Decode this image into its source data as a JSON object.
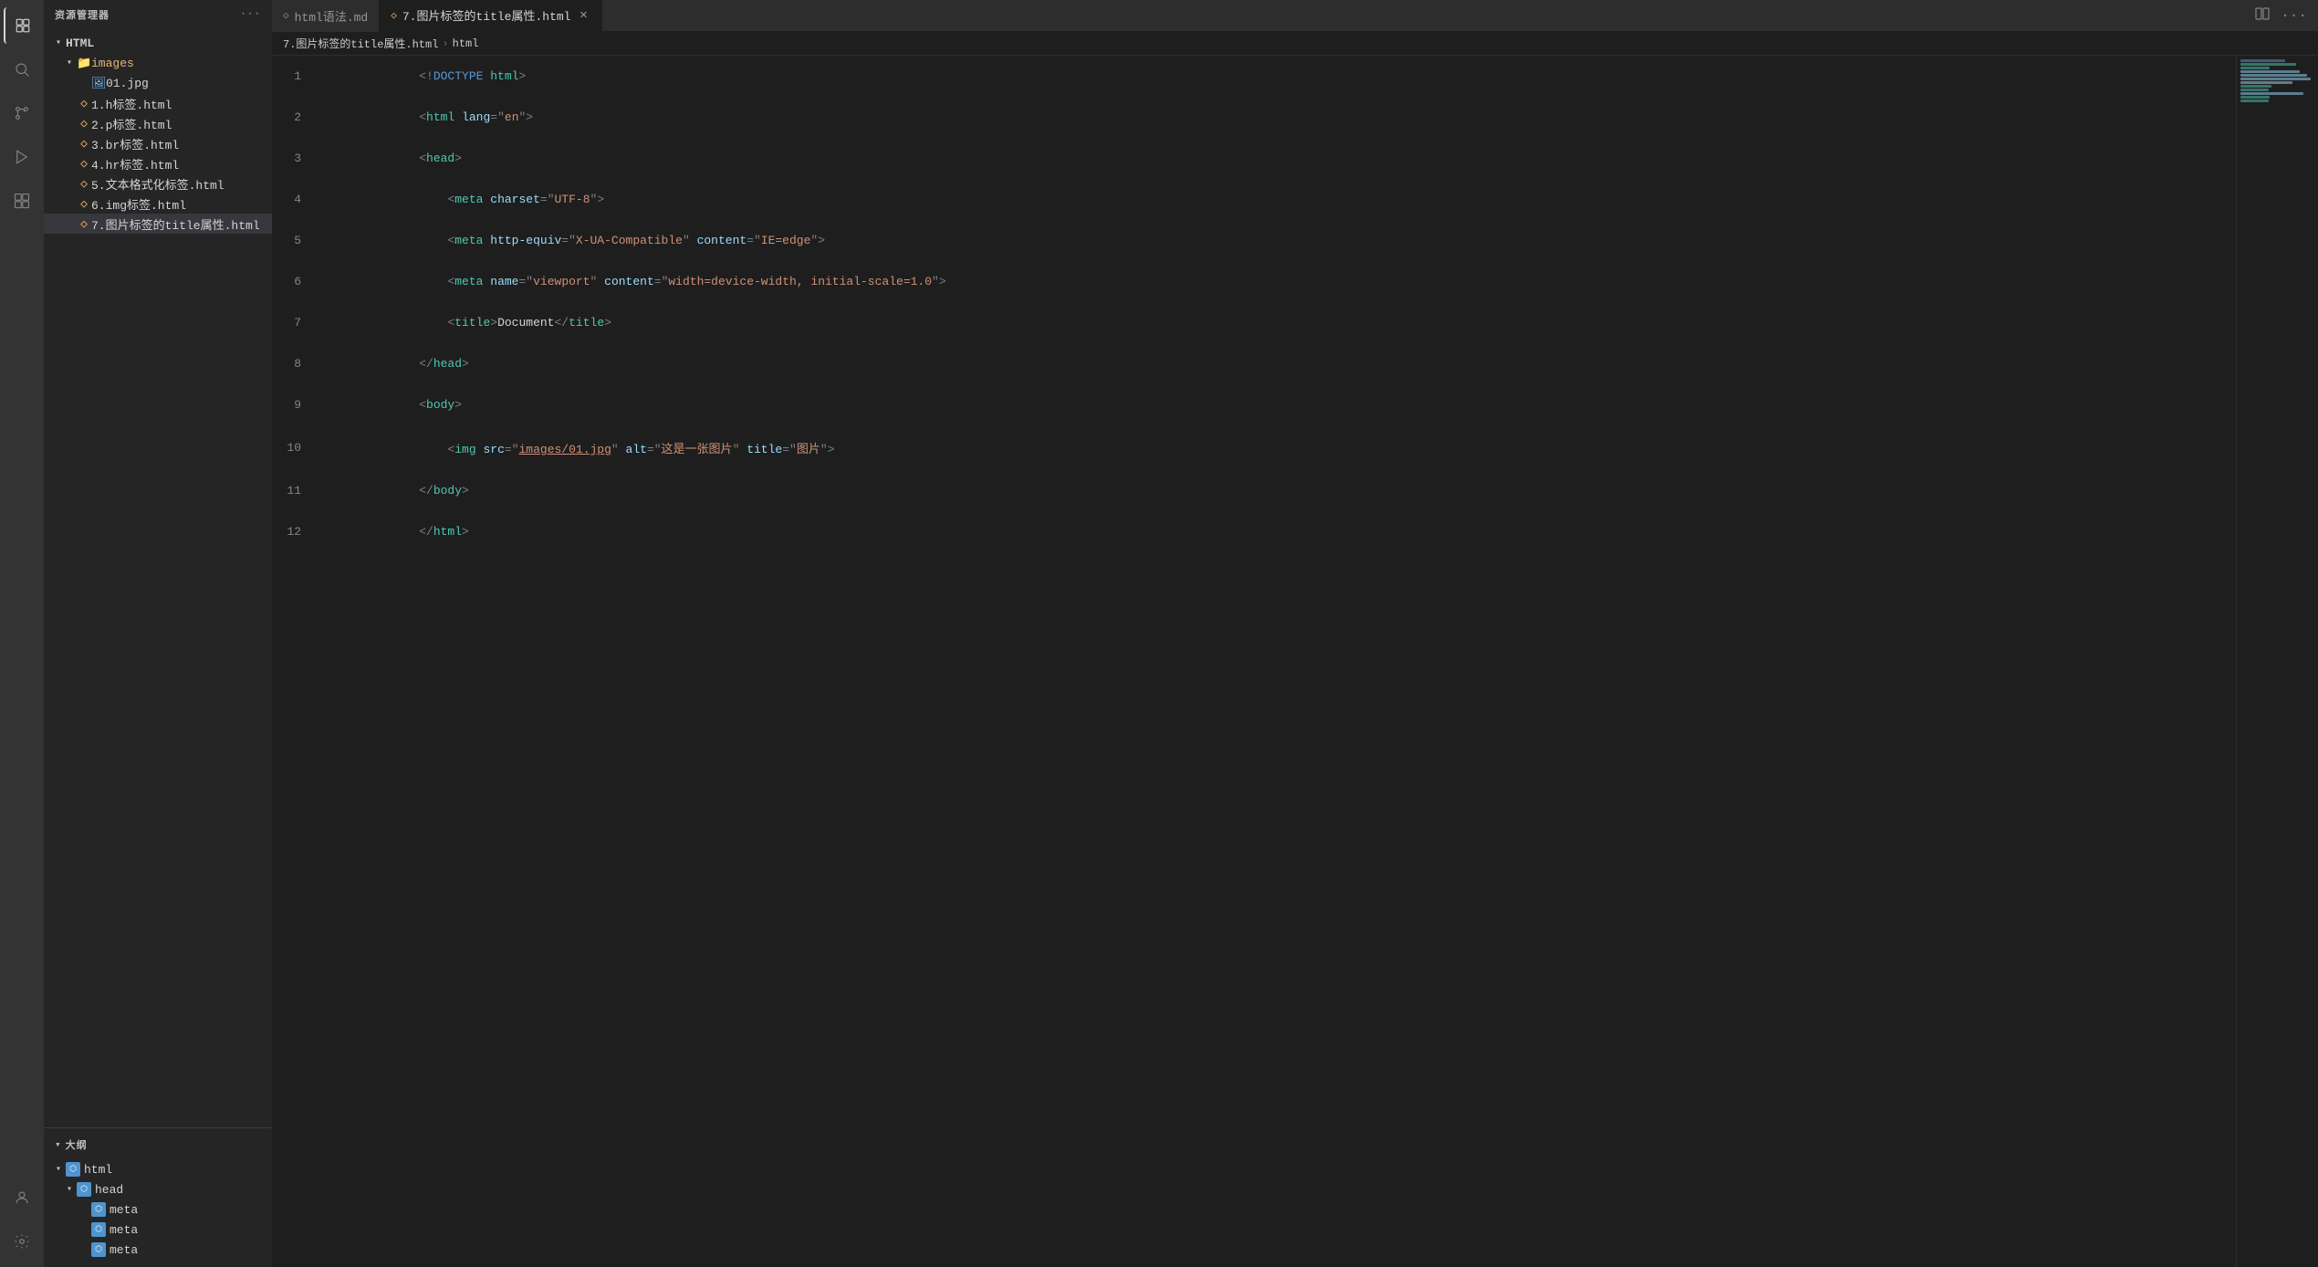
{
  "activityBar": {
    "icons": [
      {
        "name": "explorer-icon",
        "symbol": "⬜",
        "active": true,
        "label": "Explorer"
      },
      {
        "name": "search-icon",
        "symbol": "🔍",
        "active": false,
        "label": "Search"
      },
      {
        "name": "git-icon",
        "symbol": "⎇",
        "active": false,
        "label": "Source Control"
      },
      {
        "name": "debug-icon",
        "symbol": "▷",
        "active": false,
        "label": "Run"
      },
      {
        "name": "extensions-icon",
        "symbol": "⧉",
        "active": false,
        "label": "Extensions"
      }
    ],
    "bottomIcons": [
      {
        "name": "account-icon",
        "symbol": "👤",
        "label": "Account"
      },
      {
        "name": "settings-icon",
        "symbol": "⚙",
        "label": "Settings"
      }
    ]
  },
  "sidebar": {
    "title": "资源管理器",
    "tree": {
      "rootLabel": "HTML",
      "items": [
        {
          "id": "images-folder",
          "type": "folder",
          "label": "images",
          "indent": 1,
          "expanded": true
        },
        {
          "id": "01jpg",
          "type": "image",
          "label": "01.jpg",
          "indent": 2,
          "expanded": false
        },
        {
          "id": "file1",
          "type": "html",
          "label": "1.h标签.html",
          "indent": 1
        },
        {
          "id": "file2",
          "type": "html",
          "label": "2.p标签.html",
          "indent": 1
        },
        {
          "id": "file3",
          "type": "html",
          "label": "3.br标签.html",
          "indent": 1
        },
        {
          "id": "file4",
          "type": "html",
          "label": "4.hr标签.html",
          "indent": 1
        },
        {
          "id": "file5",
          "type": "html",
          "label": "5.文本格式化标签.html",
          "indent": 1
        },
        {
          "id": "file6",
          "type": "html",
          "label": "6.img标签.html",
          "indent": 1
        },
        {
          "id": "file7",
          "type": "html",
          "label": "7.图片标签的title属性.html",
          "indent": 1,
          "active": true
        }
      ]
    }
  },
  "outline": {
    "title": "大纲",
    "items": [
      {
        "id": "html-node",
        "label": "html",
        "indent": 0,
        "expanded": true
      },
      {
        "id": "head-node",
        "label": "head",
        "indent": 1,
        "expanded": true
      },
      {
        "id": "meta1-node",
        "label": "meta",
        "indent": 2
      },
      {
        "id": "meta2-node",
        "label": "meta",
        "indent": 2
      },
      {
        "id": "meta3-node",
        "label": "meta",
        "indent": 2
      }
    ]
  },
  "tabs": [
    {
      "id": "tab-htmlmd",
      "label": "html语法.md",
      "icon": "◇",
      "active": false,
      "closable": false,
      "modified": false
    },
    {
      "id": "tab-title",
      "label": "7.图片标签的title属性.html",
      "icon": "◇",
      "active": true,
      "closable": true,
      "modified": false
    }
  ],
  "breadcrumb": {
    "items": [
      {
        "label": "7.图片标签的title属性.html"
      },
      {
        "label": "html"
      }
    ]
  },
  "editor": {
    "filename": "7.图片标签的title属性.html",
    "lines": [
      {
        "num": 1,
        "tokens": [
          {
            "t": "punct",
            "v": "<!"
          },
          {
            "t": "excl",
            "v": "DOCTYPE"
          },
          {
            "t": "text",
            "v": " "
          },
          {
            "t": "tag",
            "v": "html"
          },
          {
            "t": "punct",
            "v": ">"
          }
        ]
      },
      {
        "num": 2,
        "tokens": [
          {
            "t": "punct",
            "v": "<"
          },
          {
            "t": "tag",
            "v": "html"
          },
          {
            "t": "text",
            "v": " "
          },
          {
            "t": "attr",
            "v": "lang"
          },
          {
            "t": "punct",
            "v": "=\""
          },
          {
            "t": "val",
            "v": "en"
          },
          {
            "t": "punct",
            "v": "\">"
          }
        ]
      },
      {
        "num": 3,
        "tokens": [
          {
            "t": "punct",
            "v": "<"
          },
          {
            "t": "tag",
            "v": "head"
          },
          {
            "t": "punct",
            "v": ">"
          }
        ]
      },
      {
        "num": 4,
        "tokens": [
          {
            "t": "text",
            "v": "    "
          },
          {
            "t": "punct",
            "v": "<"
          },
          {
            "t": "tag",
            "v": "meta"
          },
          {
            "t": "text",
            "v": " "
          },
          {
            "t": "attr",
            "v": "charset"
          },
          {
            "t": "punct",
            "v": "=\""
          },
          {
            "t": "val",
            "v": "UTF-8"
          },
          {
            "t": "punct",
            "v": "\">"
          }
        ]
      },
      {
        "num": 5,
        "tokens": [
          {
            "t": "text",
            "v": "    "
          },
          {
            "t": "punct",
            "v": "<"
          },
          {
            "t": "tag",
            "v": "meta"
          },
          {
            "t": "text",
            "v": " "
          },
          {
            "t": "attr",
            "v": "http-equiv"
          },
          {
            "t": "punct",
            "v": "=\""
          },
          {
            "t": "val",
            "v": "X-UA-Compatible"
          },
          {
            "t": "punct",
            "v": "\""
          },
          {
            "t": "text",
            "v": " "
          },
          {
            "t": "attr",
            "v": "content"
          },
          {
            "t": "punct",
            "v": "=\""
          },
          {
            "t": "val",
            "v": "IE=edge"
          },
          {
            "t": "punct",
            "v": "\">"
          }
        ]
      },
      {
        "num": 6,
        "tokens": [
          {
            "t": "text",
            "v": "    "
          },
          {
            "t": "punct",
            "v": "<"
          },
          {
            "t": "tag",
            "v": "meta"
          },
          {
            "t": "text",
            "v": " "
          },
          {
            "t": "attr",
            "v": "name"
          },
          {
            "t": "punct",
            "v": "=\""
          },
          {
            "t": "val",
            "v": "viewport"
          },
          {
            "t": "punct",
            "v": "\""
          },
          {
            "t": "text",
            "v": " "
          },
          {
            "t": "attr",
            "v": "content"
          },
          {
            "t": "punct",
            "v": "=\""
          },
          {
            "t": "val",
            "v": "width=device-width, initial-scale=1.0"
          },
          {
            "t": "punct",
            "v": "\">"
          }
        ]
      },
      {
        "num": 7,
        "tokens": [
          {
            "t": "text",
            "v": "    "
          },
          {
            "t": "punct",
            "v": "<"
          },
          {
            "t": "tag",
            "v": "title"
          },
          {
            "t": "punct",
            "v": ">"
          },
          {
            "t": "text",
            "v": "Document"
          },
          {
            "t": "punct",
            "v": "</"
          },
          {
            "t": "tag",
            "v": "title"
          },
          {
            "t": "punct",
            "v": ">"
          }
        ]
      },
      {
        "num": 8,
        "tokens": [
          {
            "t": "punct",
            "v": "</"
          },
          {
            "t": "tag",
            "v": "head"
          },
          {
            "t": "punct",
            "v": ">"
          }
        ]
      },
      {
        "num": 9,
        "tokens": [
          {
            "t": "punct",
            "v": "<"
          },
          {
            "t": "tag",
            "v": "body"
          },
          {
            "t": "punct",
            "v": ">"
          }
        ]
      },
      {
        "num": 10,
        "tokens": [
          {
            "t": "text",
            "v": "    "
          },
          {
            "t": "punct",
            "v": "<"
          },
          {
            "t": "tag",
            "v": "img"
          },
          {
            "t": "text",
            "v": " "
          },
          {
            "t": "attr",
            "v": "src"
          },
          {
            "t": "punct",
            "v": "=\""
          },
          {
            "t": "val",
            "v": "images/01.jpg",
            "underline": true
          },
          {
            "t": "punct",
            "v": "\""
          },
          {
            "t": "text",
            "v": " "
          },
          {
            "t": "attr",
            "v": "alt"
          },
          {
            "t": "punct",
            "v": "=\""
          },
          {
            "t": "val",
            "v": "这是一张图片"
          },
          {
            "t": "punct",
            "v": "\""
          },
          {
            "t": "text",
            "v": " "
          },
          {
            "t": "attr",
            "v": "title"
          },
          {
            "t": "punct",
            "v": "=\""
          },
          {
            "t": "val",
            "v": "图片"
          },
          {
            "t": "punct",
            "v": "\">"
          }
        ]
      },
      {
        "num": 11,
        "tokens": [
          {
            "t": "punct",
            "v": "</"
          },
          {
            "t": "tag",
            "v": "body"
          },
          {
            "t": "punct",
            "v": ">"
          }
        ]
      },
      {
        "num": 12,
        "tokens": [
          {
            "t": "punct",
            "v": "</"
          },
          {
            "t": "tag",
            "v": "html"
          },
          {
            "t": "punct",
            "v": ">"
          }
        ]
      }
    ]
  }
}
